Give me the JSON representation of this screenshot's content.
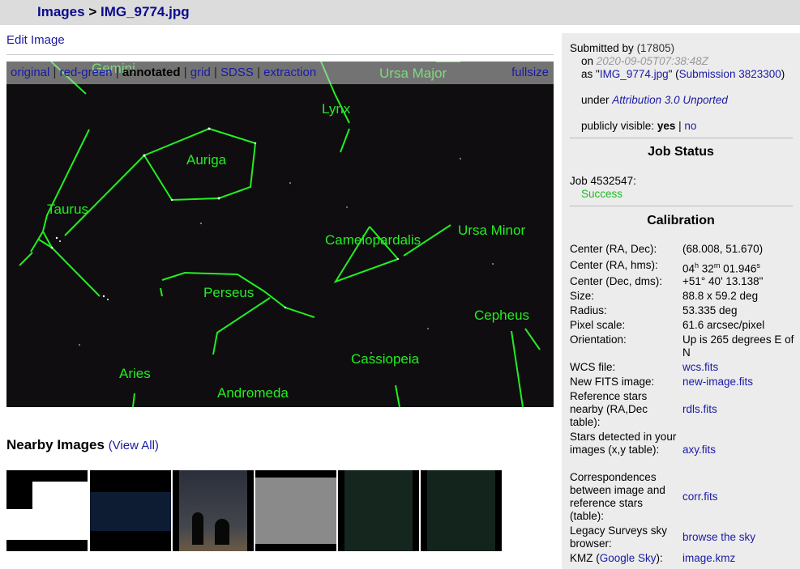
{
  "breadcrumb": {
    "images_label": "Images",
    "separator": ">",
    "file_name": "IMG_9774.jpg"
  },
  "edit_image_label": "Edit Image",
  "view_modes": [
    "original",
    "red-green",
    "annotated",
    "grid",
    "SDSS",
    "extraction"
  ],
  "selected_view": "annotated",
  "fullsize_label": "fullsize",
  "constellations": [
    "Gemini",
    "Ursa Major",
    "Lynx",
    "Auriga",
    "Taurus",
    "Camelopardalis",
    "Ursa Minor",
    "Perseus",
    "Cepheus",
    "Cassiopeia",
    "Aries",
    "Andromeda"
  ],
  "annotation_color": "#22ee22",
  "nearby": {
    "title": "Nearby Images",
    "view_all_label": "(View All)"
  },
  "submission": {
    "submitted_by": "Submitted by",
    "user": "(17805)",
    "on_label": "on",
    "timestamp": "2020-09-05T07:38:48Z",
    "as_prefix": "as \"",
    "file_link": "IMG_9774.jpg",
    "submission_link": "Submission 3823300",
    "as_suffix": "\" (",
    "close_paren": ")",
    "under_label": "under",
    "license": "Attribution 3.0 Unported",
    "visible_label": "publicly visible:",
    "visible_yes": "yes",
    "visible_sep": "|",
    "visible_no": "no"
  },
  "job_status": {
    "title": "Job Status",
    "job": "Job 4532547:",
    "status": "Success"
  },
  "calibration": {
    "title": "Calibration",
    "rows": [
      {
        "key": "Center (RA, Dec):",
        "value": "(68.008, 51.670)"
      },
      {
        "key": "Center (RA, hms):",
        "value": "04h 32m 01.946s"
      },
      {
        "key": "Center (Dec, dms):",
        "value": "+51° 40' 13.138\""
      },
      {
        "key": "Size:",
        "value": "88.8 x 59.2 deg"
      },
      {
        "key": "Radius:",
        "value": "53.335 deg"
      },
      {
        "key": "Pixel scale:",
        "value": "61.6 arcsec/pixel"
      },
      {
        "key": "Orientation:",
        "value": "Up is 265 degrees E of N"
      },
      {
        "key": "WCS file:",
        "value": "wcs.fits"
      },
      {
        "key": "New FITS image:",
        "value": "new-image.fits"
      },
      {
        "key": "Reference stars nearby (RA,Dec table):",
        "value": "rdls.fits"
      },
      {
        "key": "Stars detected in your images (x,y table):",
        "value": "axy.fits"
      },
      {
        "key": "Correspondences between image and reference stars (table):",
        "value": "corr.fits"
      },
      {
        "key": "Legacy Surveys sky browser:",
        "value": "browse the sky"
      },
      {
        "key_prefix": "KMZ (",
        "key_link": "Google Sky",
        "key_suffix": "):",
        "value": "image.kmz"
      }
    ]
  }
}
